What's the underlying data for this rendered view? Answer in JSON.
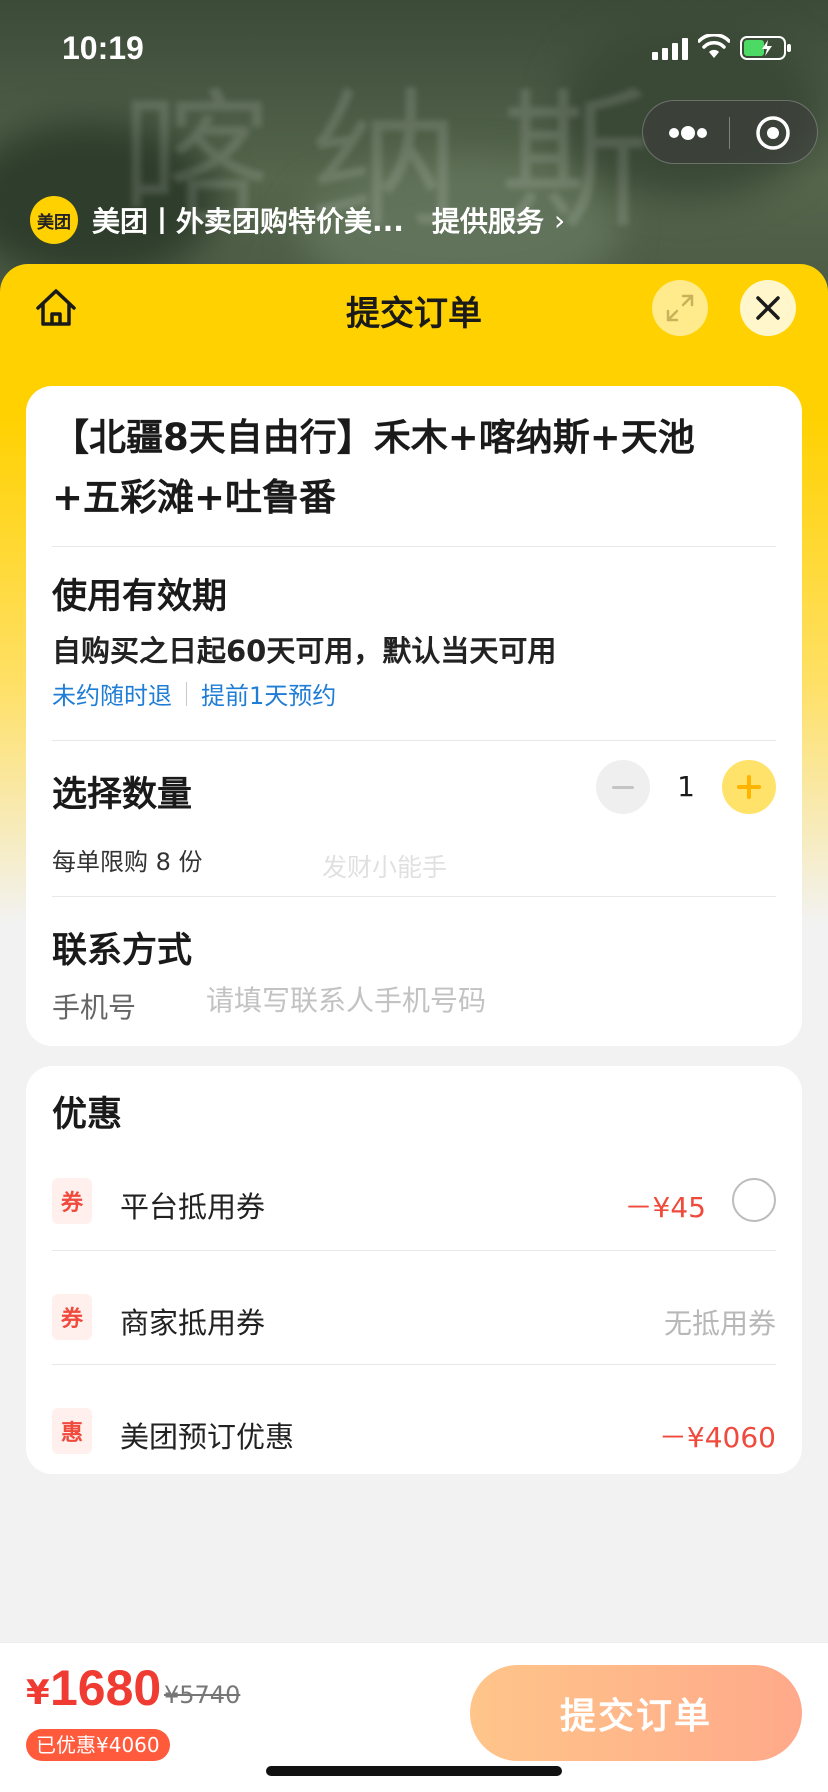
{
  "status": {
    "time": "10:19"
  },
  "background": {
    "watermark": "喀纳斯"
  },
  "miniprogram": {
    "logo_text": "美团",
    "name": "美团丨外卖团购特价美...",
    "serve_label": "提供服务",
    "chevron": "›"
  },
  "nav": {
    "title": "提交订单"
  },
  "product": {
    "title": "【北疆8天自由行】禾木+喀纳斯+天池+五彩滩+吐鲁番"
  },
  "validity": {
    "heading": "使用有效期",
    "text": "自购买之日起60天可用，默认当天可用",
    "tags": [
      "未约随时退",
      "提前1天预约"
    ]
  },
  "quantity": {
    "heading": "选择数量",
    "value": "1",
    "limit_text": "每单限购 8 份",
    "watermark": "发财小能手"
  },
  "contact": {
    "heading": "联系方式",
    "phone_label": "手机号",
    "phone_placeholder": "请填写联系人手机号码"
  },
  "discounts": {
    "heading": "优惠",
    "items": [
      {
        "badge": "券",
        "name": "平台抵用券",
        "value": "－¥45"
      },
      {
        "badge": "券",
        "name": "商家抵用券",
        "value": "无抵用券"
      },
      {
        "badge": "惠",
        "name": "美团预订优惠",
        "value": "－¥4060"
      }
    ]
  },
  "footer": {
    "currency": "¥",
    "price": "1680",
    "original_price": "¥5740",
    "saved_text": "已优惠¥4060",
    "submit_label": "提交订单"
  },
  "colors": {
    "brand_yellow": "#ffd100",
    "price_red": "#ef3b32",
    "link_blue": "#1f7dd6",
    "submit_gradient_start": "#ffc58a",
    "submit_gradient_end": "#ffa98a"
  }
}
